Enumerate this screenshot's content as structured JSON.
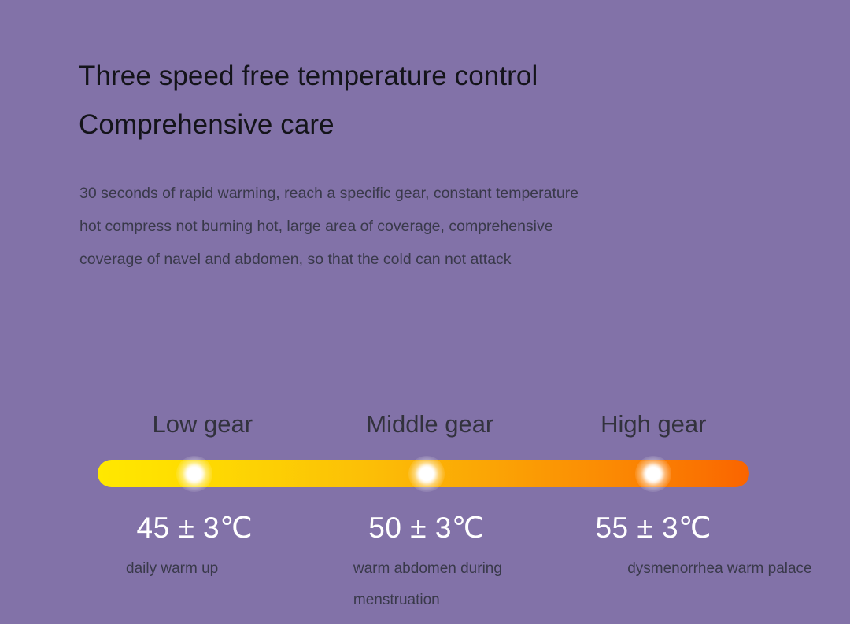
{
  "theme": {
    "background_color": "#8272A8",
    "heading_color": "#14141A",
    "body_color": "#39394A",
    "temp_color": "#FFFFFF",
    "gradient_start_color": "#FFE800",
    "gradient_mid_color": "#FCBE06",
    "gradient_end_color": "#FA6400",
    "dot_color": "#FFFFFF"
  },
  "headline": {
    "line1": "Three speed free temperature control",
    "line2": "Comprehensive care"
  },
  "body": {
    "line1": "30 seconds of rapid warming, reach a specific gear, constant temperature",
    "line2": "hot compress not burning hot, large area of coverage, comprehensive",
    "line3": "coverage of navel and abdomen, so that the cold can not attack"
  },
  "gears": [
    {
      "label": "Low gear",
      "temperature": "45 ± 3℃",
      "caption": "daily warm up",
      "dot_percent": 14.9,
      "label_center_percent": 16.1,
      "temp_center_percent": 14.9,
      "caption_left_percent": 4.0
    },
    {
      "label": "Middle gear",
      "temperature": "50 ± 3℃",
      "caption": "warm abdomen during menstruation",
      "dot_percent": 50.5,
      "label_center_percent": 51.0,
      "temp_center_percent": 50.5,
      "caption_left_percent": 36.1
    },
    {
      "label": "High gear",
      "temperature": "55 ± 3℃",
      "caption": "dysmenorrhea warm palace",
      "dot_percent": 85.3,
      "label_center_percent": 85.3,
      "temp_center_percent": 85.3,
      "caption_left_percent": 74.8
    }
  ]
}
